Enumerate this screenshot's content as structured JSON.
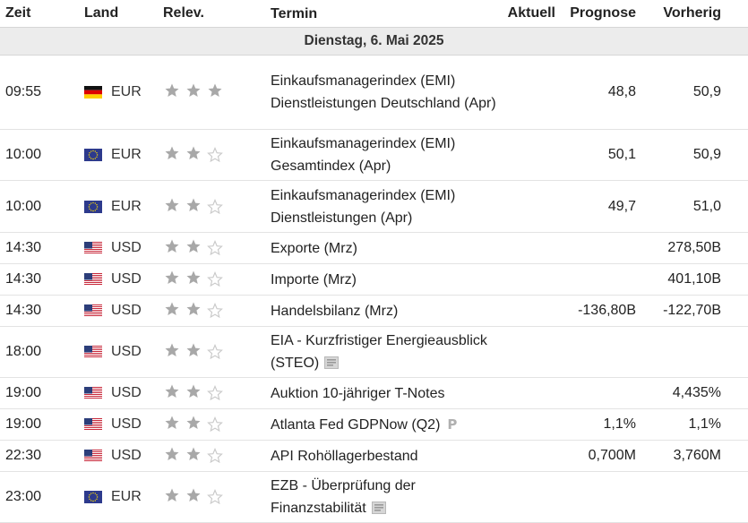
{
  "headers": {
    "time": "Zeit",
    "land": "Land",
    "relevance": "Relev.",
    "event": "Termin",
    "actual": "Aktuell",
    "forecast": "Prognose",
    "previous": "Vorherig"
  },
  "date_label": "Dienstag, 6. Mai 2025",
  "icons": {
    "star": "star-icon",
    "report": "document-icon",
    "preliminary": "p-icon"
  },
  "colors": {
    "star_filled": "#a8a8a8",
    "star_empty": "#c9c9c9",
    "date_row_bg": "#ececec"
  },
  "rows": [
    {
      "time": "09:55",
      "flag": "de",
      "currency": "EUR",
      "stars": 3,
      "event": "Einkaufsmanagerindex (EMI) Dienstleistungen Deutschland (Apr)",
      "actual": "",
      "forecast": "48,8",
      "previous": "50,9",
      "extra": ""
    },
    {
      "time": "10:00",
      "flag": "eu",
      "currency": "EUR",
      "stars": 2,
      "event": "Einkaufsmanagerindex (EMI) Gesamtindex (Apr)",
      "actual": "",
      "forecast": "50,1",
      "previous": "50,9",
      "extra": ""
    },
    {
      "time": "10:00",
      "flag": "eu",
      "currency": "EUR",
      "stars": 2,
      "event": "Einkaufsmanagerindex (EMI) Dienstleistungen (Apr)",
      "actual": "",
      "forecast": "49,7",
      "previous": "51,0",
      "extra": ""
    },
    {
      "time": "14:30",
      "flag": "us",
      "currency": "USD",
      "stars": 2,
      "event": "Exporte (Mrz)",
      "actual": "",
      "forecast": "",
      "previous": "278,50B",
      "extra": ""
    },
    {
      "time": "14:30",
      "flag": "us",
      "currency": "USD",
      "stars": 2,
      "event": "Importe (Mrz)",
      "actual": "",
      "forecast": "",
      "previous": "401,10B",
      "extra": ""
    },
    {
      "time": "14:30",
      "flag": "us",
      "currency": "USD",
      "stars": 2,
      "event": "Handelsbilanz (Mrz)",
      "actual": "",
      "forecast": "-136,80B",
      "previous": "-122,70B",
      "extra": ""
    },
    {
      "time": "18:00",
      "flag": "us",
      "currency": "USD",
      "stars": 2,
      "event": "EIA - Kurzfristiger Energieausblick (STEO)",
      "actual": "",
      "forecast": "",
      "previous": "",
      "extra": "report"
    },
    {
      "time": "19:00",
      "flag": "us",
      "currency": "USD",
      "stars": 2,
      "event": "Auktion 10-jähriger T-Notes",
      "actual": "",
      "forecast": "",
      "previous": "4,435%",
      "extra": ""
    },
    {
      "time": "19:00",
      "flag": "us",
      "currency": "USD",
      "stars": 2,
      "event": "Atlanta Fed GDPNow (Q2)",
      "actual": "",
      "forecast": "1,1%",
      "previous": "1,1%",
      "extra": "preliminary"
    },
    {
      "time": "22:30",
      "flag": "us",
      "currency": "USD",
      "stars": 2,
      "event": "API Rohöllagerbestand",
      "actual": "",
      "forecast": "0,700M",
      "previous": "3,760M",
      "extra": ""
    },
    {
      "time": "23:00",
      "flag": "eu",
      "currency": "EUR",
      "stars": 2,
      "event": "EZB - Überprüfung der Finanzstabilität",
      "actual": "",
      "forecast": "",
      "previous": "",
      "extra": "report"
    }
  ]
}
